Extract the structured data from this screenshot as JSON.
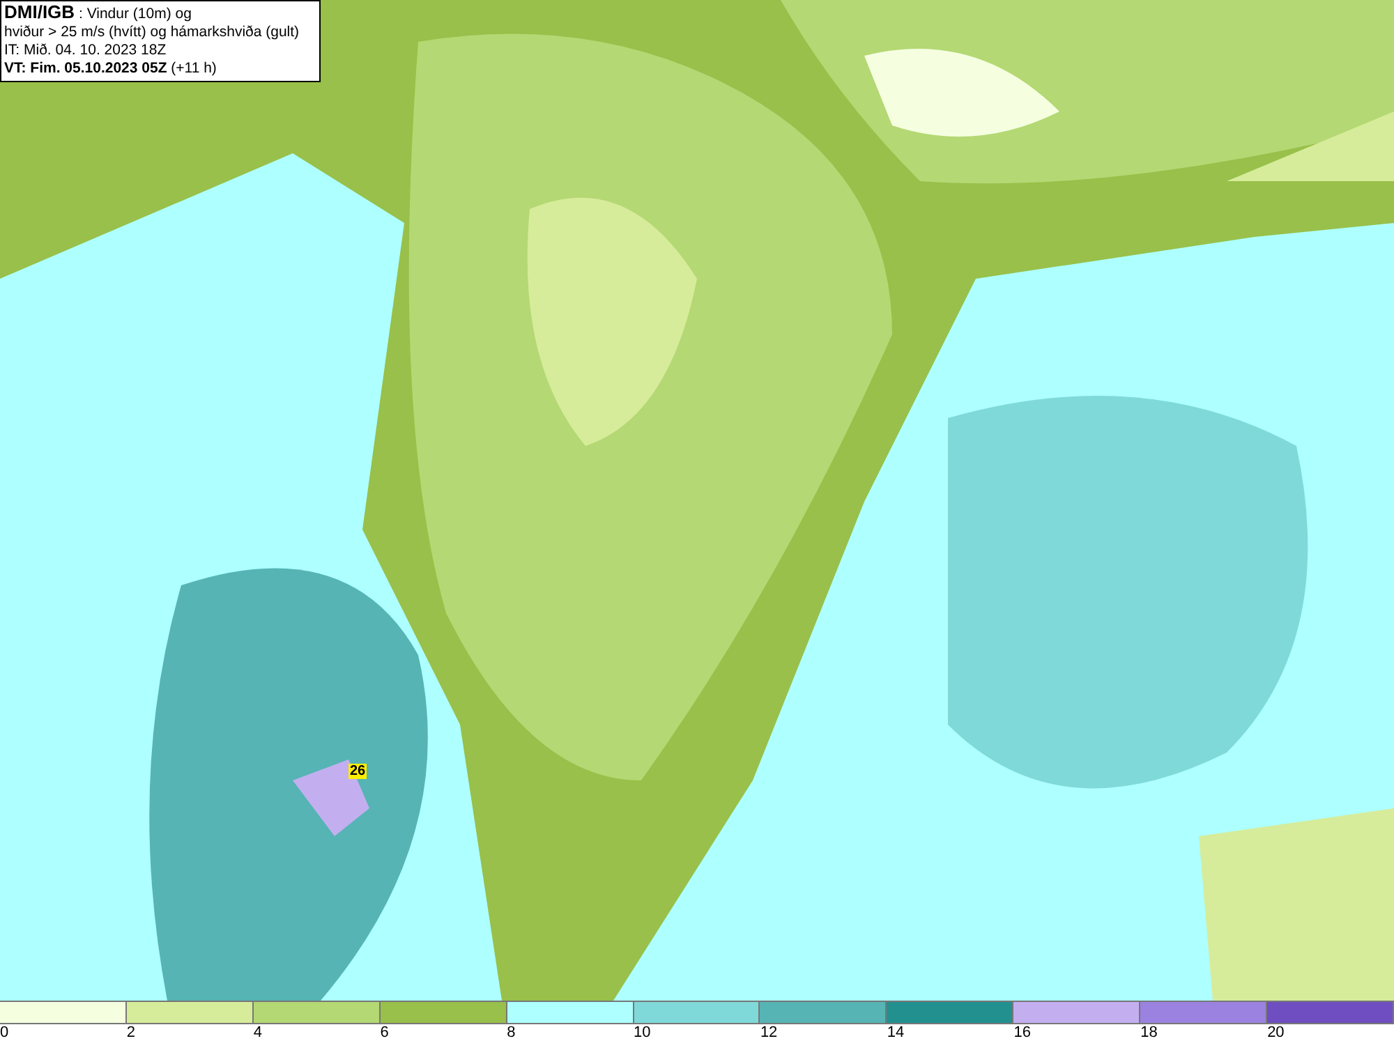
{
  "header": {
    "lines": [
      "**DMI/IGB** : Vindur (10m) og",
      "hviður > 25 m/s (hvítt) og hámarkshviða (gult)",
      "IT: Mið. 04. 10. 2023 18Z",
      "**VT: Fim. 05.10.2023 05Z** (+11 h)"
    ]
  },
  "gust_labels": [
    {
      "text": "26"
    }
  ],
  "legend": {
    "bins": [
      {
        "color": "#f5ffe0"
      },
      {
        "color": "#d6ec9a"
      },
      {
        "color": "#b4d873"
      },
      {
        "color": "#98c04a"
      },
      {
        "color": "#aeffff"
      },
      {
        "color": "#80d9d9"
      },
      {
        "color": "#56b4b4"
      },
      {
        "color": "#239090"
      },
      {
        "color": "#c3aff0"
      },
      {
        "color": "#9b82e0"
      },
      {
        "color": "#6e4ec0"
      }
    ],
    "ticks": [
      "0",
      "2",
      "4",
      "6",
      "8",
      "10",
      "12",
      "14",
      "16",
      "18",
      "20"
    ]
  }
}
